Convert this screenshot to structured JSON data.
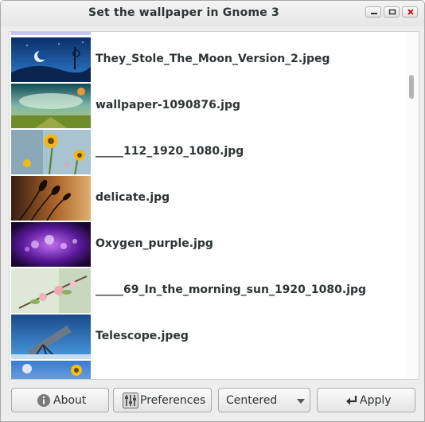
{
  "window": {
    "title": "Set the wallpaper in Gnome 3",
    "controls": [
      "minimize-icon",
      "maximize-icon",
      "close-icon"
    ]
  },
  "files": [
    {
      "name": "",
      "thumb": "purple-top"
    },
    {
      "name": "They_Stole_The_Moon_Version_2.jpeg",
      "thumb": "moon-night"
    },
    {
      "name": "wallpaper-1090876.jpg",
      "thumb": "green-field"
    },
    {
      "name": "_____112_1920_1080.jpg",
      "thumb": "yellow-flowers"
    },
    {
      "name": "delicate.jpg",
      "thumb": "dry-plants"
    },
    {
      "name": "Oxygen_purple.jpg",
      "thumb": "purple-bokeh"
    },
    {
      "name": "_____69_In_the_morning_sun_1920_1080.jpg",
      "thumb": "blossom"
    },
    {
      "name": "Telescope.jpeg",
      "thumb": "telescope"
    },
    {
      "name": "",
      "thumb": "sunflower-sky"
    }
  ],
  "buttons": {
    "about": "About",
    "preferences": "Preferences",
    "mode": "Centered",
    "apply": "Apply"
  },
  "colors": {
    "accent_close": "#cc0000",
    "text": "#2e3436"
  }
}
